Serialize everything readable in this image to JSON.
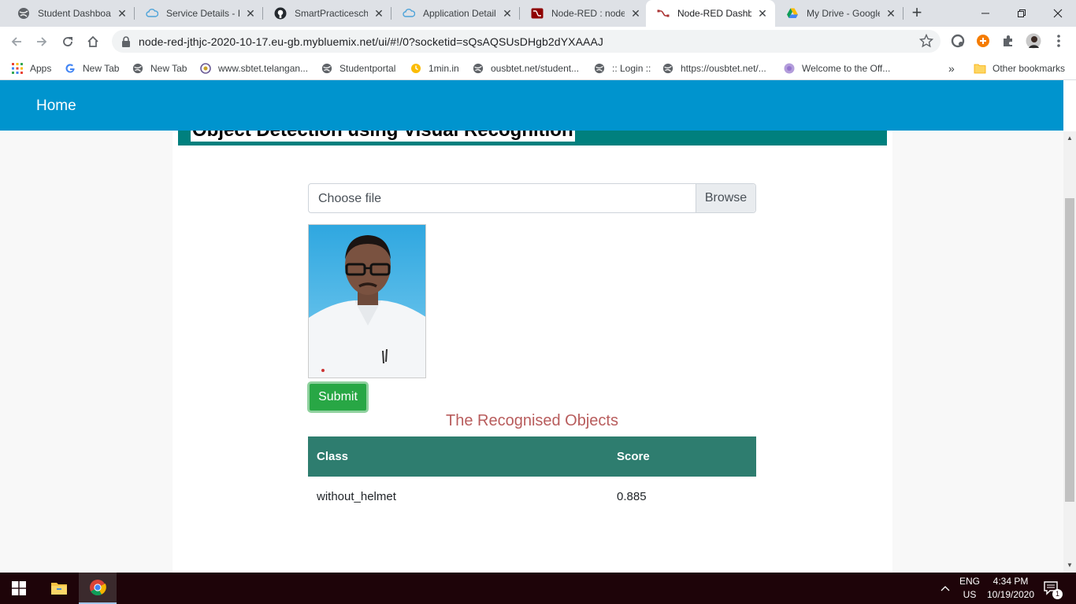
{
  "tabs": [
    {
      "title": "Student Dashboard",
      "icon": "globe-icon",
      "active": false
    },
    {
      "title": "Service Details - IBM",
      "icon": "cloud-icon",
      "active": false
    },
    {
      "title": "SmartPracticeschool",
      "icon": "github-icon",
      "active": false
    },
    {
      "title": "Application Details",
      "icon": "cloud-icon",
      "active": false
    },
    {
      "title": "Node-RED : node-",
      "icon": "node-red-icon",
      "active": false
    },
    {
      "title": "Node-RED Dashboard",
      "icon": "node-red-icon",
      "active": true
    },
    {
      "title": "My Drive - Google Drive",
      "icon": "google-drive-icon",
      "active": false
    }
  ],
  "toolbar": {
    "url": "node-red-jthjc-2020-10-17.eu-gb.mybluemix.net/ui/#!/0?socketid=sQsAQSUsDHgb2dYXAAAJ"
  },
  "bookmarks": {
    "items": [
      {
        "label": "Apps",
        "icon": "apps-grid-icon"
      },
      {
        "label": "New Tab",
        "icon": "google-icon"
      },
      {
        "label": "New Tab",
        "icon": "globe-icon"
      },
      {
        "label": "www.sbtet.telangan...",
        "icon": "seal-icon"
      },
      {
        "label": "Studentportal",
        "icon": "globe-icon"
      },
      {
        "label": "1min.in",
        "icon": "clock-icon"
      },
      {
        "label": "ousbtet.net/student...",
        "icon": "globe-icon"
      },
      {
        "label": ":: Login ::",
        "icon": "globe-icon"
      },
      {
        "label": "https://ousbtet.net/...",
        "icon": "globe-icon"
      },
      {
        "label": "Welcome to the Off...",
        "icon": "purple-circle-icon"
      }
    ],
    "overflow": "»",
    "other": "Other bookmarks"
  },
  "app": {
    "title": "Home",
    "header_text": "Object Detection using Visual Recognition"
  },
  "form": {
    "file_label": "Choose file",
    "browse_label": "Browse",
    "submit_label": "Submit"
  },
  "results": {
    "title": "The Recognised Objects",
    "columns": [
      "Class",
      "Score"
    ],
    "rows": [
      {
        "class": "without_helmet",
        "score": "0.885"
      }
    ]
  },
  "taskbar": {
    "lang_line1": "ENG",
    "lang_line2": "US",
    "time": "4:34 PM",
    "date": "10/19/2020",
    "notification_count": "1"
  },
  "colors": {
    "appbar": "#0094ce",
    "header_strip": "#00807e",
    "submit": "#28a745",
    "table_header": "#2e7d6f",
    "results_title": "#b85c5c"
  }
}
